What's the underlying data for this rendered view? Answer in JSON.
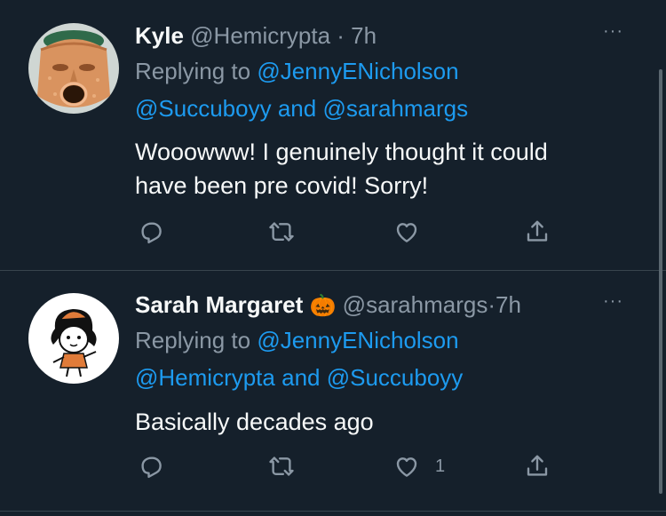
{
  "tweets": [
    {
      "name": "Kyle",
      "handle": "@Hemicrypta",
      "dot": "·",
      "time": "7h",
      "replying_prefix": "Replying to",
      "mention1": "@JennyENicholson",
      "mention2": "@Succuboyy",
      "and": "and",
      "mention3": "@sarahmargs",
      "text_line1": "Wooowww! I genuinely thought it could",
      "text_line2": "have been pre covid! Sorry!",
      "more": "···",
      "avatar_icon": "terracotta-face-planter"
    },
    {
      "name": "Sarah Margaret",
      "emoji": "🎃",
      "handle": "@sarahmargs",
      "dot": "·",
      "time": "7h",
      "replying_prefix": "Replying to",
      "mention1": "@JennyENicholson",
      "mention2": "@Hemicrypta",
      "and": "and",
      "mention3": "@Succuboyy",
      "text": "Basically decades ago",
      "more": "···",
      "like_count": "1",
      "avatar_icon": "cartoon-girl-drawing"
    }
  ],
  "colors": {
    "background": "#15202b",
    "text": "#f7f9f9",
    "secondary": "#8b98a5",
    "link": "#1d9bf0",
    "divider": "#38444d"
  },
  "icons": [
    "reply-icon",
    "retweet-icon",
    "like-icon",
    "share-icon",
    "more-icon"
  ]
}
